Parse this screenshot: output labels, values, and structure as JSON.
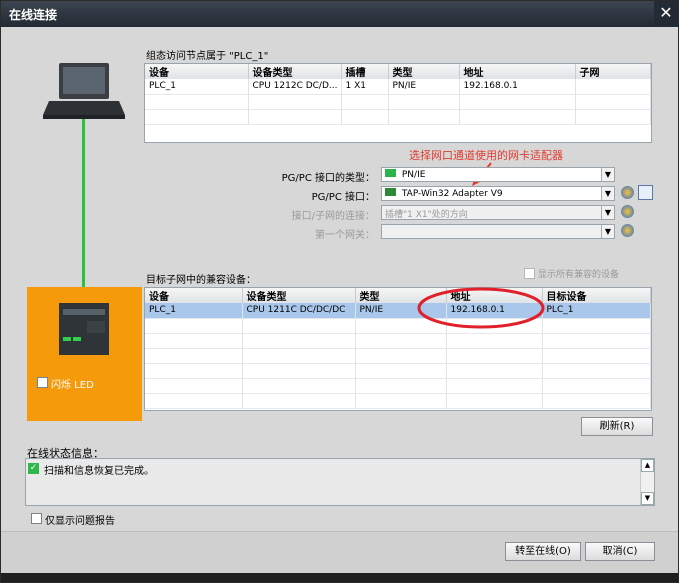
{
  "window": {
    "title": "在线连接",
    "close_glyph": "✕"
  },
  "config": {
    "caption": "组态访问节点属于 \"PLC_1\"",
    "columns": [
      "设备",
      "设备类型",
      "插槽",
      "类型",
      "地址",
      "子网"
    ],
    "rows": [
      [
        "PLC_1",
        "CPU 1212C DC/D...",
        "1 X1",
        "PN/IE",
        "192.168.0.1",
        ""
      ]
    ]
  },
  "annotation": {
    "text": "选择网口通道使用的网卡适配器",
    "color": "#e23b2e"
  },
  "settings": {
    "pgpc_type_label": "PG/PC 接口的类型：",
    "pgpc_type_value": "PN/IE",
    "pgpc_if_label": "PG/PC 接口：",
    "pgpc_if_value": "TAP-Win32 Adapter V9",
    "subnet_conn_label": "接口/子网的连接：",
    "subnet_conn_value": "插槽\"1 X1\"处的方向",
    "gateway_label": "第一个网关："
  },
  "target": {
    "caption": "目标子网中的兼容设备：",
    "show_all_label": "显示所有兼容的设备",
    "columns": [
      "设备",
      "设备类型",
      "类型",
      "地址",
      "目标设备"
    ],
    "rows": [
      [
        "PLC_1",
        "CPU 1211C DC/DC/DC",
        "PN/IE",
        "192.168.0.1",
        "PLC_1"
      ]
    ]
  },
  "flash_led_label": "闪烁 LED",
  "refresh_label": "刷新(R)",
  "status": {
    "caption": "在线状态信息：",
    "message": "扫描和信息恢复已完成。",
    "only_problems_label": "仅显示问题报告"
  },
  "footer": {
    "go_online": "转至在线(O)",
    "cancel": "取消(C)"
  },
  "colors": {
    "link_line": "#27c437",
    "device_panel": "#f59a0b",
    "ellipse": "#e0202a",
    "selection": "#a9c7ea"
  },
  "icons": [
    "pc-laptop-icon",
    "plc-device-icon",
    "network-adapter-icon",
    "pn-ie-icon",
    "status-ok-icon",
    "drop-arrow-icon",
    "properties-icon",
    "zoom-icon"
  ]
}
